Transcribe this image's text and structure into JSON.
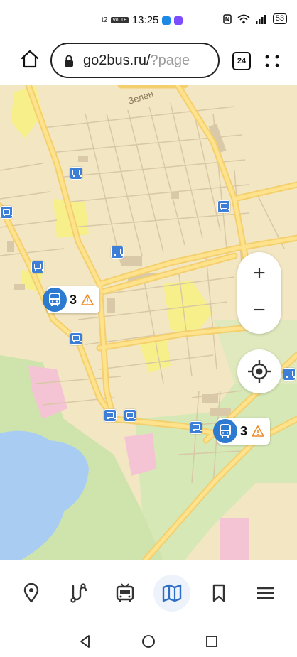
{
  "status_bar": {
    "carrier": "t2",
    "volte": "VoLTE",
    "time": "13:25",
    "battery": "53",
    "icons": [
      "nfc-icon",
      "wifi-icon",
      "signal-icon",
      "battery-icon"
    ],
    "app_icon_colors": [
      "#1e88e5",
      "#7c4dff"
    ]
  },
  "browser": {
    "url_host": "go2bus.ru/",
    "url_path": "?page",
    "tab_count": "24",
    "icons": [
      "home-icon",
      "lock-icon",
      "menu-dots-icon"
    ]
  },
  "map": {
    "street_label": "Зелен",
    "colors": {
      "land": "#f3e6c2",
      "water": "#a9cdf2",
      "forest": "#cfe3ad",
      "road": "#ffd45e",
      "industrial": "#f5c4d4",
      "block": "#f6ef8a",
      "stop": "#3d7fd6",
      "vehicle": "#2d7ad1",
      "warning": "#f08a24"
    },
    "vehicles": [
      {
        "route": "3",
        "warning": true
      },
      {
        "route": "3",
        "warning": true
      }
    ],
    "zoom_in": "+",
    "zoom_out": "−"
  },
  "bottom_nav": {
    "items": [
      {
        "icon": "map-pin-icon",
        "active": false
      },
      {
        "icon": "route-icon",
        "active": false
      },
      {
        "icon": "bus-icon",
        "active": false
      },
      {
        "icon": "map-icon",
        "active": true
      },
      {
        "icon": "bookmark-icon",
        "active": false
      },
      {
        "icon": "hamburger-menu-icon",
        "active": false
      }
    ]
  },
  "system_nav": {
    "icons": [
      "back-triangle-icon",
      "home-circle-icon",
      "recents-square-icon"
    ]
  }
}
